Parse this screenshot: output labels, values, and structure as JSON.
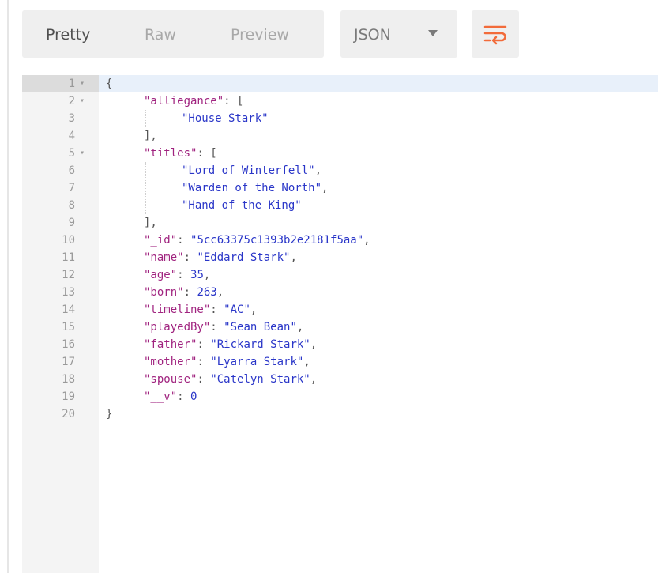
{
  "toolbar": {
    "tabs": [
      {
        "label": "Pretty",
        "active": true
      },
      {
        "label": "Raw",
        "active": false
      },
      {
        "label": "Preview",
        "active": false
      }
    ],
    "format": "JSON",
    "wrap_icon": "wrap-lines-icon",
    "accent_color": "#f26b3a"
  },
  "editor": {
    "lines": [
      {
        "n": "1",
        "fold": true,
        "indent": 0,
        "type": "open",
        "text": "{"
      },
      {
        "n": "2",
        "fold": true,
        "indent": 1,
        "type": "key-open",
        "key": "\"alliegance\"",
        "text": ": ["
      },
      {
        "n": "3",
        "fold": false,
        "indent": 2,
        "type": "str",
        "text": "\"House Stark\""
      },
      {
        "n": "4",
        "fold": false,
        "indent": 1,
        "type": "punc",
        "text": "],"
      },
      {
        "n": "5",
        "fold": true,
        "indent": 1,
        "type": "key-open",
        "key": "\"titles\"",
        "text": ": ["
      },
      {
        "n": "6",
        "fold": false,
        "indent": 2,
        "type": "str",
        "text": "\"Lord of Winterfell\"",
        "after": ","
      },
      {
        "n": "7",
        "fold": false,
        "indent": 2,
        "type": "str",
        "text": "\"Warden of the North\"",
        "after": ","
      },
      {
        "n": "8",
        "fold": false,
        "indent": 2,
        "type": "str",
        "text": "\"Hand of the King\""
      },
      {
        "n": "9",
        "fold": false,
        "indent": 1,
        "type": "punc",
        "text": "],"
      },
      {
        "n": "10",
        "fold": false,
        "indent": 1,
        "type": "kv",
        "key": "\"_id\"",
        "value": "\"5cc63375c1393b2e2181f5aa\"",
        "after": ","
      },
      {
        "n": "11",
        "fold": false,
        "indent": 1,
        "type": "kv",
        "key": "\"name\"",
        "value": "\"Eddard Stark\"",
        "after": ","
      },
      {
        "n": "12",
        "fold": false,
        "indent": 1,
        "type": "kv",
        "key": "\"age\"",
        "value": "35",
        "after": ","
      },
      {
        "n": "13",
        "fold": false,
        "indent": 1,
        "type": "kv",
        "key": "\"born\"",
        "value": "263",
        "after": ","
      },
      {
        "n": "14",
        "fold": false,
        "indent": 1,
        "type": "kv",
        "key": "\"timeline\"",
        "value": "\"AC\"",
        "after": ","
      },
      {
        "n": "15",
        "fold": false,
        "indent": 1,
        "type": "kv",
        "key": "\"playedBy\"",
        "value": "\"Sean Bean\"",
        "after": ","
      },
      {
        "n": "16",
        "fold": false,
        "indent": 1,
        "type": "kv",
        "key": "\"father\"",
        "value": "\"Rickard Stark\"",
        "after": ","
      },
      {
        "n": "17",
        "fold": false,
        "indent": 1,
        "type": "kv",
        "key": "\"mother\"",
        "value": "\"Lyarra Stark\"",
        "after": ","
      },
      {
        "n": "18",
        "fold": false,
        "indent": 1,
        "type": "kv",
        "key": "\"spouse\"",
        "value": "\"Catelyn Stark\"",
        "after": ","
      },
      {
        "n": "19",
        "fold": false,
        "indent": 1,
        "type": "kv",
        "key": "\"__v\"",
        "value": "0",
        "after": ""
      },
      {
        "n": "20",
        "fold": false,
        "indent": 0,
        "type": "close",
        "text": "}"
      }
    ]
  }
}
